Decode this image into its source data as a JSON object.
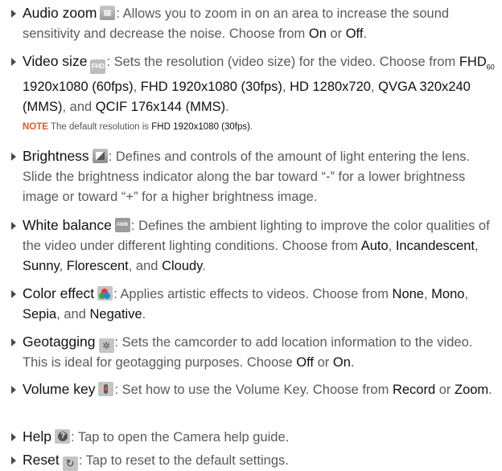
{
  "items": [
    {
      "id": "audio_zoom",
      "term": "Audio zoom",
      "icon": "audio-zoom-icon",
      "parts": [
        {
          "t": ": Allows you to zoom in on an area to increase the sound sensitivity and decrease the noise. Choose from "
        },
        {
          "o": "On"
        },
        {
          "t": " or "
        },
        {
          "o": "Off"
        },
        {
          "t": "."
        }
      ]
    },
    {
      "id": "video_size",
      "term": "Video size",
      "icon": "fhd-icon",
      "icon_text": "FHD",
      "parts": [
        {
          "t": ": Sets the resolution (video size) for the video. Choose from "
        },
        {
          "o": "FHD"
        },
        {
          "sub": "60"
        },
        {
          "o": " 1920x1080 (60fps)"
        },
        {
          "t": ", "
        },
        {
          "o": "FHD 1920x1080 (30fps)"
        },
        {
          "t": ", "
        },
        {
          "o": "HD 1280x720"
        },
        {
          "t": ", "
        },
        {
          "o": "QVGA 320x240 (MMS)"
        },
        {
          "t": ", and "
        },
        {
          "o": "QCIF 176x144 (MMS)"
        },
        {
          "t": "."
        }
      ]
    },
    {
      "id": "brightness",
      "term": "Brightness",
      "icon": "brightness-icon",
      "parts": [
        {
          "t": ": Defines and controls of the amount of light entering the lens. Slide the brightness indicator along the bar toward “-” for a lower brightness image or toward “+” for a higher brightness image."
        }
      ]
    },
    {
      "id": "white_balance",
      "term": "White balance",
      "icon": "white-balance-icon",
      "parts": [
        {
          "t": ": Defines the ambient lighting to improve the color qualities of the video under different lighting conditions. Choose from "
        },
        {
          "o": "Auto"
        },
        {
          "t": ", "
        },
        {
          "o": "Incandescent"
        },
        {
          "t": ", "
        },
        {
          "o": "Sunny"
        },
        {
          "t": ", "
        },
        {
          "o": "Florescent"
        },
        {
          "t": ", and "
        },
        {
          "o": "Cloudy"
        },
        {
          "t": "."
        }
      ]
    },
    {
      "id": "color_effect",
      "term": "Color effect",
      "icon": "color-effect-icon",
      "parts": [
        {
          "t": ": Applies artistic effects to videos. Choose from "
        },
        {
          "o": "None"
        },
        {
          "t": ", "
        },
        {
          "o": "Mono"
        },
        {
          "t": ", "
        },
        {
          "o": "Sepia"
        },
        {
          "t": ", and "
        },
        {
          "o": "Negative"
        },
        {
          "t": "."
        }
      ]
    },
    {
      "id": "geotagging",
      "term": "Geotagging",
      "icon": "geotagging-icon",
      "parts": [
        {
          "t": ": Sets the camcorder to add location information to the video. This is ideal for geotagging purposes. Choose "
        },
        {
          "o": "Off"
        },
        {
          "t": " or "
        },
        {
          "o": "On"
        },
        {
          "t": "."
        }
      ]
    },
    {
      "id": "volume_key",
      "term": "Volume key",
      "icon": "volume-key-icon",
      "parts": [
        {
          "t": ": Set how to use the Volume Key. Choose from "
        },
        {
          "o": "Record"
        },
        {
          "t": " or "
        },
        {
          "o": "Zoom"
        },
        {
          "t": "."
        }
      ]
    },
    {
      "id": "help",
      "term": "Help",
      "icon": "help-icon",
      "parts": [
        {
          "t": ": Tap to open the Camera help guide."
        }
      ]
    },
    {
      "id": "reset",
      "term": "Reset",
      "icon": "reset-icon",
      "parts": [
        {
          "t": ": Tap to reset to the default settings."
        }
      ]
    }
  ],
  "note": {
    "label": "NOTE",
    "text": " The default resolution is ",
    "value": "FHD 1920x1080 (30fps)",
    "end": "."
  },
  "colors": {
    "body_text": "#5a5a5a",
    "term_text": "#111111",
    "note_label": "#e8552b"
  }
}
